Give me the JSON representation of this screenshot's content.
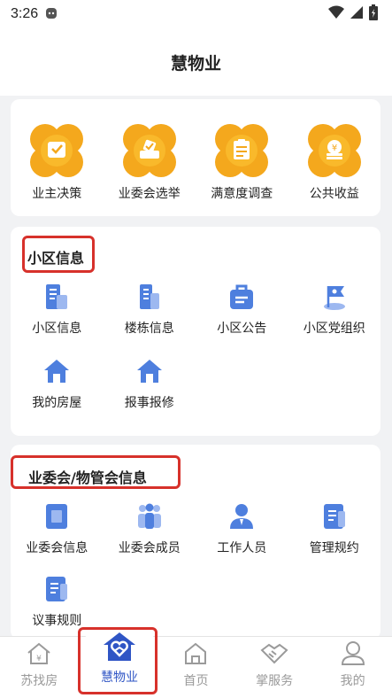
{
  "status": {
    "time": "3:26"
  },
  "header": {
    "title": "慧物业"
  },
  "decision": {
    "items": [
      {
        "label": "业主决策",
        "icon": "vote-card-icon"
      },
      {
        "label": "业委会选举",
        "icon": "ballot-box-icon"
      },
      {
        "label": "满意度调查",
        "icon": "survey-clipboard-icon"
      },
      {
        "label": "公共收益",
        "icon": "coin-stack-icon"
      }
    ]
  },
  "community": {
    "title": "小区信息",
    "items": [
      {
        "label": "小区信息",
        "icon": "building-icon"
      },
      {
        "label": "楼栋信息",
        "icon": "tower-icon"
      },
      {
        "label": "小区公告",
        "icon": "notice-bag-icon"
      },
      {
        "label": "小区党组织",
        "icon": "party-flag-icon"
      },
      {
        "label": "我的房屋",
        "icon": "my-house-icon"
      },
      {
        "label": "报事报修",
        "icon": "repair-house-icon"
      }
    ]
  },
  "committee": {
    "title": "业委会/物管会信息",
    "items": [
      {
        "label": "业委会信息",
        "icon": "info-doc-icon"
      },
      {
        "label": "业委会成员",
        "icon": "members-icon"
      },
      {
        "label": "工作人员",
        "icon": "staff-icon"
      },
      {
        "label": "管理规约",
        "icon": "rules-doc-icon"
      },
      {
        "label": "议事规则",
        "icon": "procedure-doc-icon"
      }
    ]
  },
  "tabbar": {
    "tabs": [
      {
        "label": "苏找房",
        "icon": "house-yen-icon"
      },
      {
        "label": "慧物业",
        "icon": "heart-house-icon"
      },
      {
        "label": "首页",
        "icon": "home-icon"
      },
      {
        "label": "掌服务",
        "icon": "handshake-icon"
      },
      {
        "label": "我的",
        "icon": "person-icon"
      }
    ]
  },
  "colors": {
    "accent": "#2f55c5",
    "orange": "#f4a81d",
    "blue": "#4e7fde",
    "highlight": "#d7312b"
  }
}
